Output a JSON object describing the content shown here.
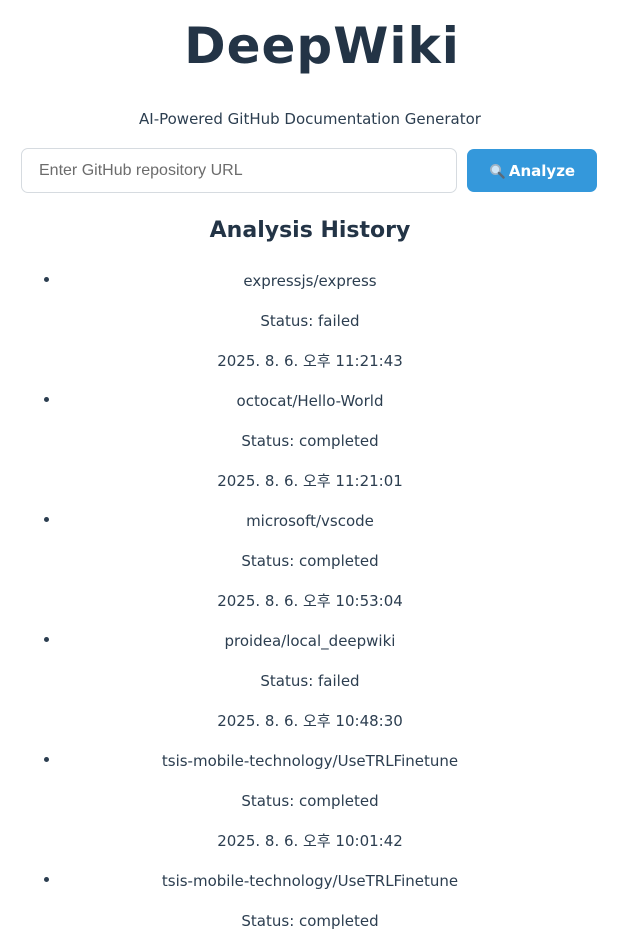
{
  "app": {
    "title": "DeepWiki",
    "subtitle": "AI-Powered GitHub Documentation Generator"
  },
  "search": {
    "placeholder": "Enter GitHub repository URL",
    "value": "",
    "button_label": "Analyze",
    "button_icon": "magnifier-icon",
    "accent_color": "#3498db"
  },
  "history": {
    "heading": "Analysis History",
    "items": [
      {
        "repo": "expressjs/express",
        "status": "Status: failed",
        "timestamp": "2025. 8. 6. 오후 11:21:43"
      },
      {
        "repo": "octocat/Hello-World",
        "status": "Status: completed",
        "timestamp": "2025. 8. 6. 오후 11:21:01"
      },
      {
        "repo": "microsoft/vscode",
        "status": "Status: completed",
        "timestamp": "2025. 8. 6. 오후 10:53:04"
      },
      {
        "repo": "proidea/local_deepwiki",
        "status": "Status: failed",
        "timestamp": "2025. 8. 6. 오후 10:48:30"
      },
      {
        "repo": "tsis-mobile-technology/UseTRLFinetune",
        "status": "Status: completed",
        "timestamp": "2025. 8. 6. 오후 10:01:42"
      },
      {
        "repo": "tsis-mobile-technology/UseTRLFinetune",
        "status": "Status: completed",
        "timestamp": ""
      }
    ]
  }
}
